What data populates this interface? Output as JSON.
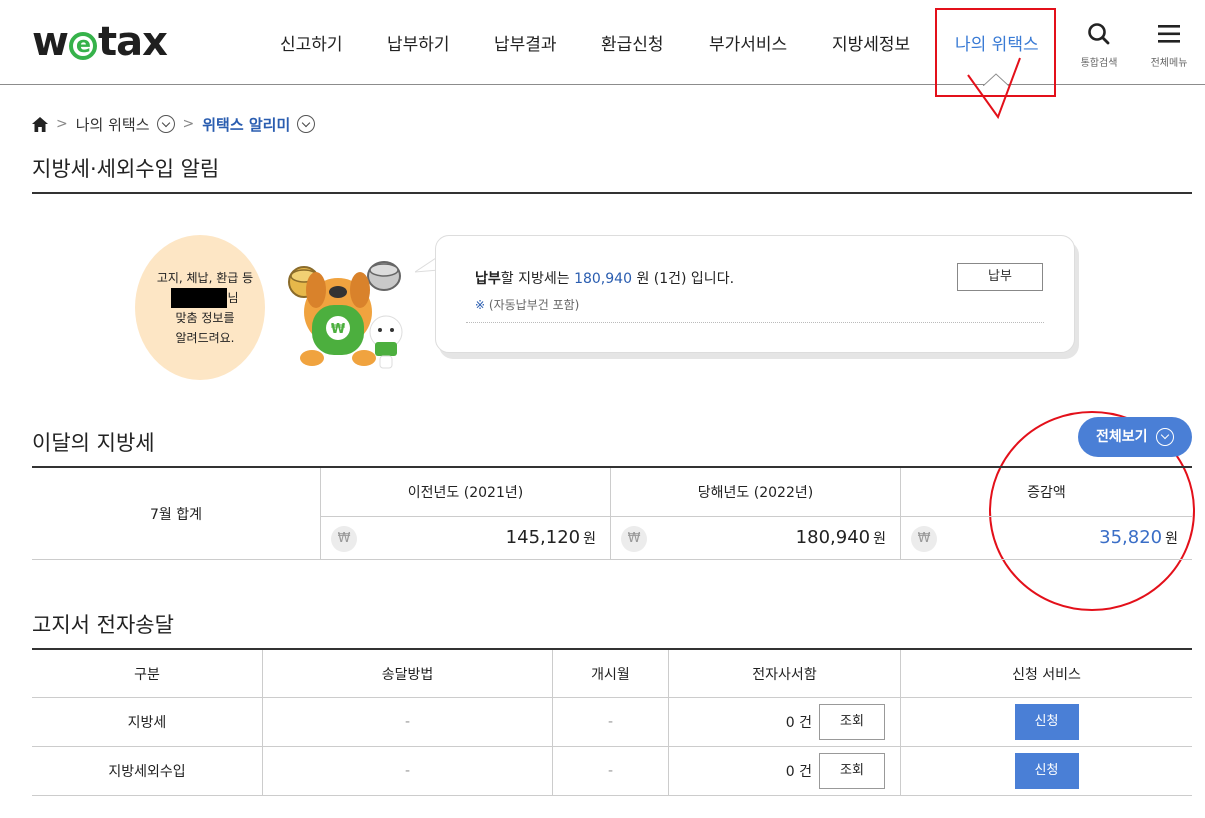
{
  "header": {
    "logo": {
      "pre": "w",
      "e": "e",
      "post": "tax"
    },
    "nav": [
      "신고하기",
      "납부하기",
      "납부결과",
      "환급신청",
      "부가서비스",
      "지방세정보",
      "나의 위택스"
    ],
    "active_index": 6,
    "search_label": "통합검색",
    "menu_label": "전체메뉴"
  },
  "breadcrumb": {
    "level1": "나의 위택스",
    "current": "위택스 알리미"
  },
  "page_title": "지방세·세외수입 알림",
  "alarm": {
    "circle_line1": "고지, 체납, 환급 등",
    "circle_line2_suffix": "님",
    "circle_line3": "맞춤 정보를",
    "circle_line4": "알려드려요.",
    "msg_bold": "납부",
    "msg_mid": "할 지방세는",
    "msg_amount": "180,940",
    "msg_tail": "원 (1건) 입니다.",
    "note_mark": "※",
    "note": "(자동납부건 포함)",
    "pay_button": "납부"
  },
  "monthly": {
    "title": "이달의 지방세",
    "view_all": "전체보기",
    "row_label": "7월 합계",
    "headers": [
      "이전년도 (2021년)",
      "당해년도 (2022년)",
      "증감액"
    ],
    "won_symbol": "₩",
    "values": [
      "145,120",
      "180,940",
      "35,820"
    ],
    "unit": "원"
  },
  "notice": {
    "title": "고지서 전자송달",
    "headers": [
      "구분",
      "송달방법",
      "개시월",
      "전자사서함",
      "신청 서비스"
    ],
    "rows": [
      {
        "type": "지방세",
        "method": "-",
        "start": "-",
        "count": "0 건",
        "view": "조회",
        "apply": "신청"
      },
      {
        "type": "지방세외수입",
        "method": "-",
        "start": "-",
        "count": "0 건",
        "view": "조회",
        "apply": "신청"
      }
    ]
  },
  "colors": {
    "accent": "#3a7bd5",
    "button_blue": "#4a7fd6",
    "annotation_red": "#e3101a",
    "logo_green": "#36b24a"
  }
}
